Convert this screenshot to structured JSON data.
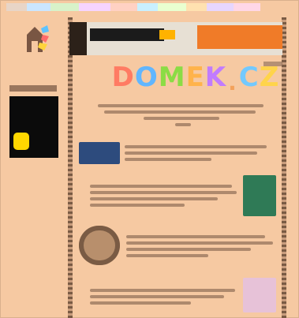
{
  "site": {
    "title_letters": [
      {
        "char": "D",
        "color": "#ff7b63"
      },
      {
        "char": "O",
        "color": "#61b6ff"
      },
      {
        "char": "M",
        "color": "#8bdc45"
      },
      {
        "char": "E",
        "color": "#ffb34b"
      },
      {
        "char": "K",
        "color": "#c17bff"
      },
      {
        "char": ".",
        "color": "#f3a15b"
      },
      {
        "char": "C",
        "color": "#73c9ff"
      },
      {
        "char": "Z",
        "color": "#ffd44a"
      }
    ]
  },
  "colors": {
    "page_bg": "#f6c9a2",
    "banner_cta_bg": "#f07b28",
    "promo_bg": "#0b0b0b",
    "promo_icon": "#ffd700"
  },
  "icons": {
    "logo": "domek-logo",
    "promo": "promo-badge-icon"
  }
}
